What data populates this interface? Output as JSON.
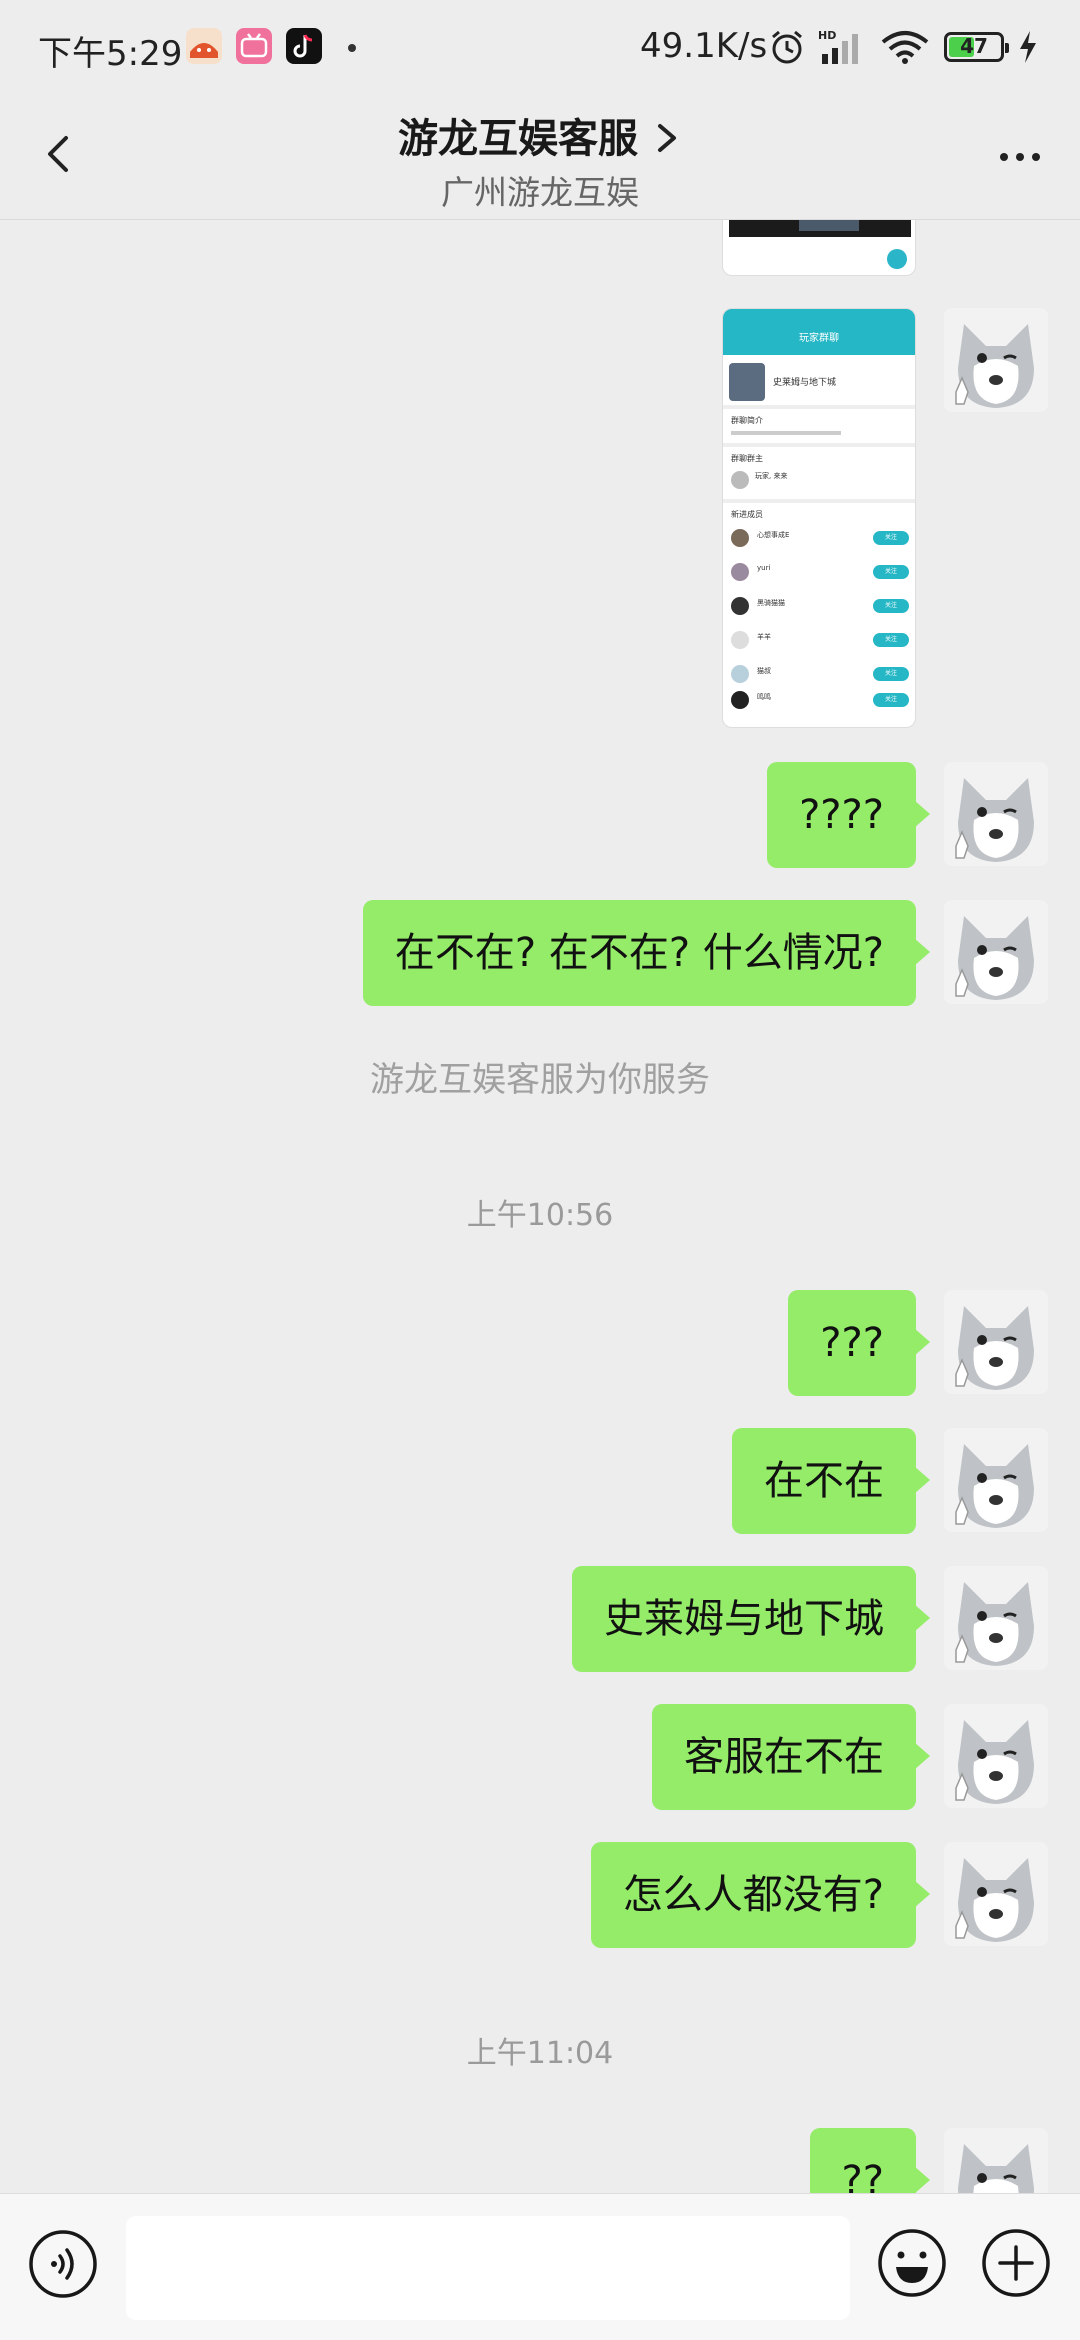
{
  "status_bar": {
    "time": "下午5:29",
    "network_speed": "49.1K/s",
    "hd_label": "HD",
    "battery_level": "47"
  },
  "header": {
    "title": "游龙互娱客服",
    "subtitle": "广州游龙互娱"
  },
  "screenshot_thumbnail": {
    "header_title": "玩家群聊",
    "game_name": "史莱姆与地下城",
    "section_intro": "群聊简介",
    "section_host": "群聊群主",
    "host_name": "玩家, 来来",
    "section_new": "新进成员",
    "members": [
      "心想事成E",
      "yuri",
      "黑骑猫猫",
      "羊羊",
      "猫叔",
      "鸣鸣"
    ],
    "join_label": "关注"
  },
  "messages": [
    {
      "type": "text",
      "text": "????"
    },
    {
      "type": "text",
      "text": "在不在? 在不在? 什么情况?"
    },
    {
      "type": "system",
      "text": "游龙互娱客服为你服务"
    },
    {
      "type": "time",
      "text": "上午10:56"
    },
    {
      "type": "text",
      "text": "???"
    },
    {
      "type": "text",
      "text": "在不在"
    },
    {
      "type": "text",
      "text": "史莱姆与地下城"
    },
    {
      "type": "text",
      "text": "客服在不在"
    },
    {
      "type": "text",
      "text": "怎么人都没有?"
    },
    {
      "type": "time",
      "text": "上午11:04"
    },
    {
      "type": "text",
      "text": "??"
    }
  ],
  "input_bar": {
    "placeholder": ""
  }
}
